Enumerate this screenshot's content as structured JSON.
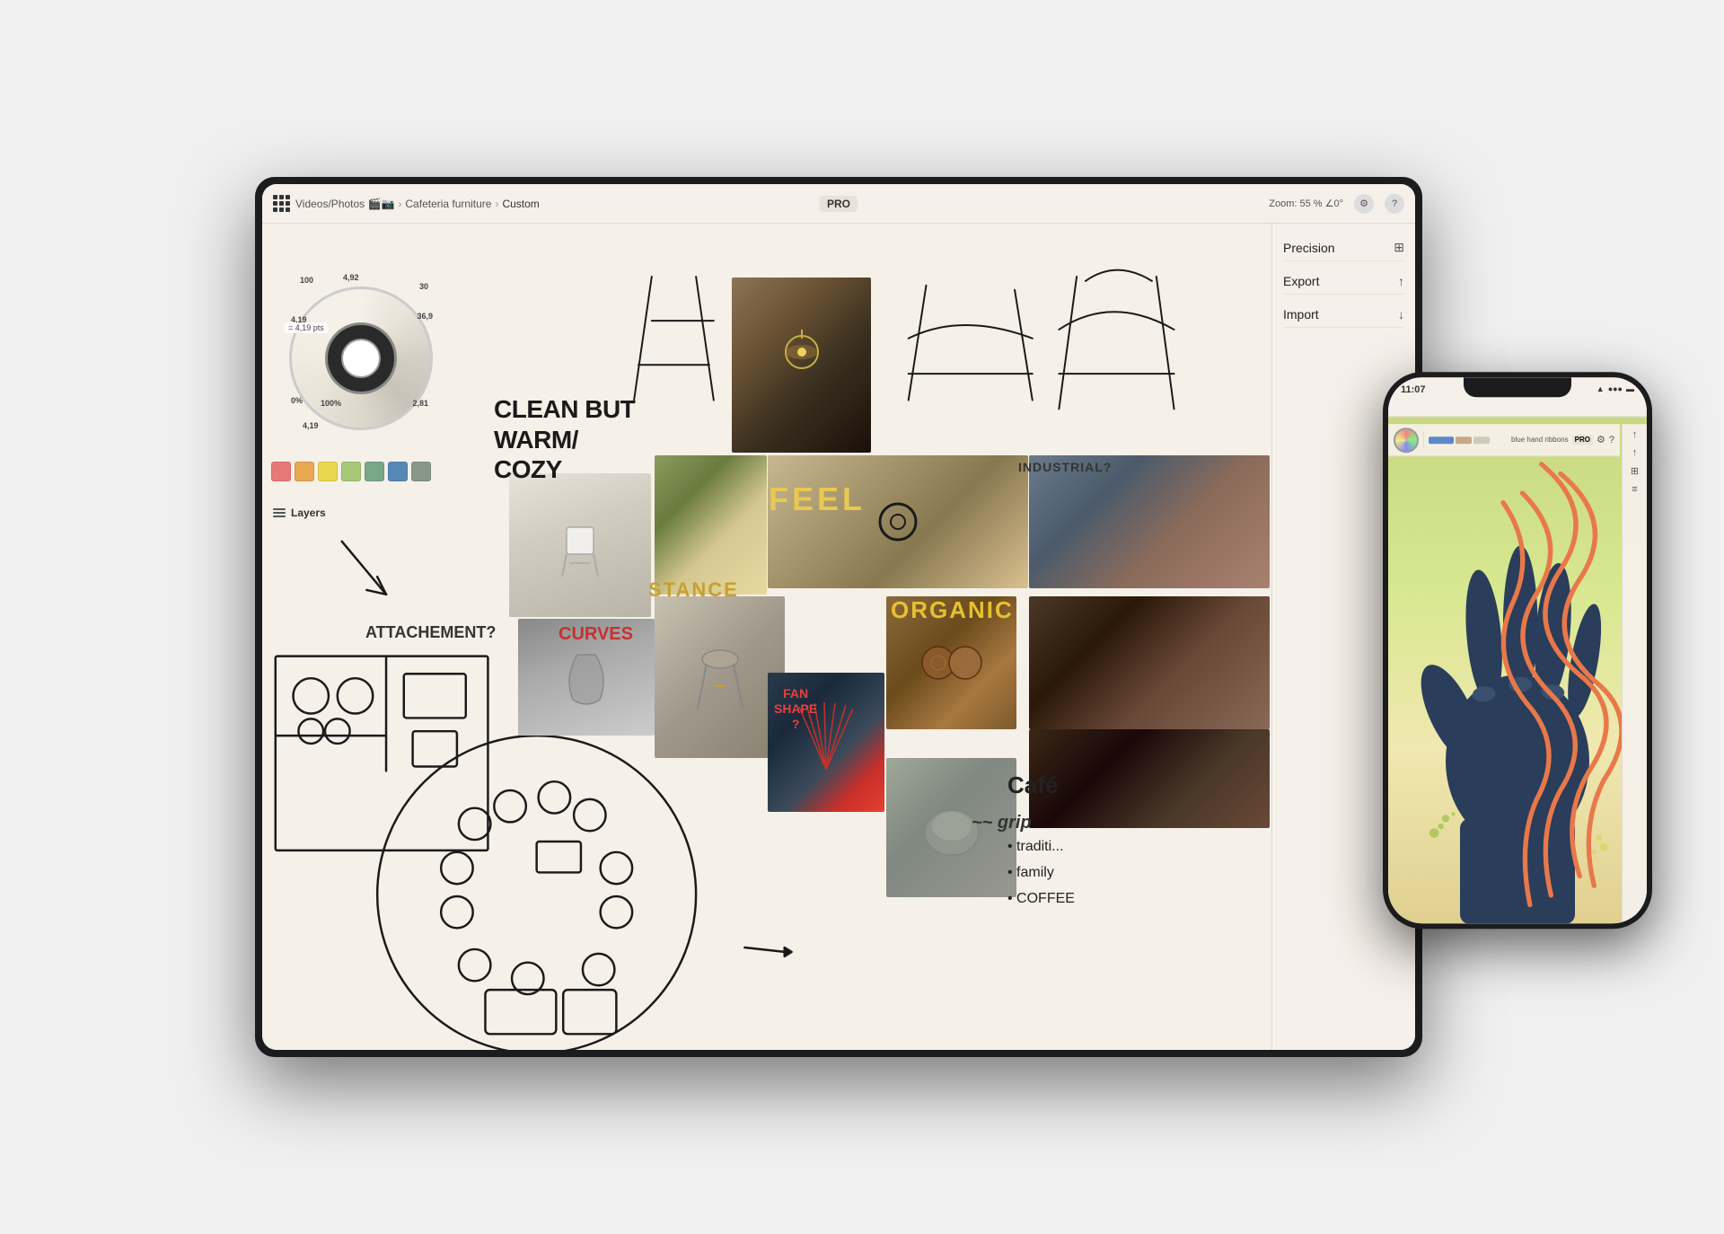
{
  "scene": {
    "background": "#d8d8d8"
  },
  "ipad": {
    "topbar": {
      "grid_icon": "⊞",
      "breadcrumb": [
        "Videos/Photos 🎬📷",
        "Cafeteria furniture",
        "Custom"
      ],
      "center_badge": "PRO",
      "zoom_label": "Zoom: 55 % ∠0°",
      "gear_icon": "⚙",
      "help_icon": "?"
    },
    "right_panel": {
      "items": [
        {
          "label": "Precision",
          "icon": "⊞"
        },
        {
          "label": "Export",
          "icon": "↑"
        },
        {
          "label": "Import",
          "icon": "↓"
        }
      ]
    },
    "canvas_texts": [
      {
        "id": "clean-but",
        "text": "CLEAN BUT\nWARM/\nCOZY"
      },
      {
        "id": "stance",
        "text": "STANCE"
      },
      {
        "id": "curves",
        "text": "CURVES"
      },
      {
        "id": "feel",
        "text": "FEEL"
      },
      {
        "id": "organic",
        "text": "ORGANIC"
      },
      {
        "id": "industrial",
        "text": "INDUSTRIAL?"
      },
      {
        "id": "attachement",
        "text": "ATTACHEMENT?"
      },
      {
        "id": "fan-shape",
        "text": "FAN\nSHAPE\n?"
      },
      {
        "id": "cafe",
        "text": "Café"
      },
      {
        "id": "grip",
        "text": "~~ grip"
      },
      {
        "id": "bullet-list",
        "text": "• traditi...\n• family\n• COFFEE"
      }
    ],
    "color_swatches": [
      "#e87878",
      "#e8a850",
      "#e8d850",
      "#a8c878",
      "#78a888",
      "#5888b8",
      "#889888"
    ],
    "stroke_label": "= 4,19 pts",
    "wheel_labels": {
      "top": "100",
      "top_right_val": "4,92",
      "right_top": "30",
      "left_mid": "4,19",
      "right_mid": "36,9",
      "right_bot": "2,81",
      "bot_left": "4,19",
      "bot_mid_left": "0%",
      "bot_mid_right": "100%"
    },
    "layers_label": "Layers"
  },
  "iphone": {
    "time": "11:07",
    "status": {
      "wifi": "WiFi",
      "signal": "●●●",
      "battery": "🔋"
    },
    "breadcrumb": [
      "blue hand ribbons"
    ],
    "pro_badge": "PRO",
    "color_swatches": [
      "#5b88c8",
      "#c8a888",
      "#d0c8b8"
    ]
  }
}
